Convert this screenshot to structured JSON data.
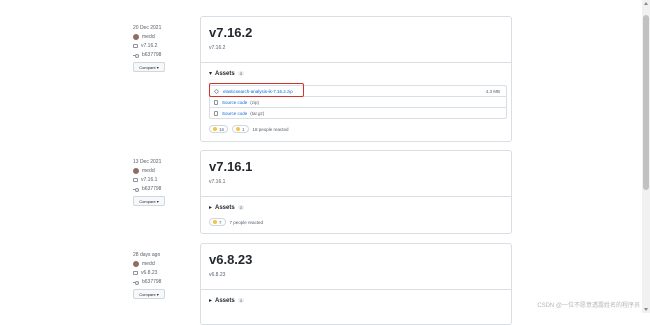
{
  "releases": [
    {
      "date": "20 Dec 2021",
      "author": "medcl",
      "tag": "v7.16.2",
      "commit": "b637798",
      "compare_label": "Compare",
      "title": "v7.16.2",
      "subtitle": "v7.16.2",
      "assets_label": "Assets",
      "assets_count": "3",
      "assets": [
        {
          "name": "elasticsearch-analysis-ik-7.16.2.zip",
          "ext": "",
          "size": "4.3 MB"
        },
        {
          "name": "Source code",
          "ext": "(zip)",
          "size": ""
        },
        {
          "name": "Source code",
          "ext": "(tar.gz)",
          "size": ""
        }
      ],
      "reactions": {
        "thumbs": "16",
        "smile": "1",
        "text": "18 people reacted"
      }
    },
    {
      "date": "13 Dec 2021",
      "author": "medcl",
      "tag": "v7.16.1",
      "commit": "b637798",
      "compare_label": "Compare",
      "title": "v7.16.1",
      "subtitle": "v7.16.1",
      "assets_label": "Assets",
      "assets_count": "3",
      "reactions": {
        "thumbs": "7",
        "text": "7 people reacted"
      }
    },
    {
      "date": "28 days ago",
      "author": "medcl",
      "tag": "v6.8.23",
      "commit": "b637798",
      "compare_label": "Compare",
      "title": "v6.8.23",
      "subtitle": "v6.8.23",
      "assets_label": "Assets",
      "assets_count": "3"
    }
  ],
  "watermark": "CSDN @一位不愿意透露姓名的程序员",
  "colors": {
    "link": "#0969da",
    "highlight": "#d0342c"
  }
}
